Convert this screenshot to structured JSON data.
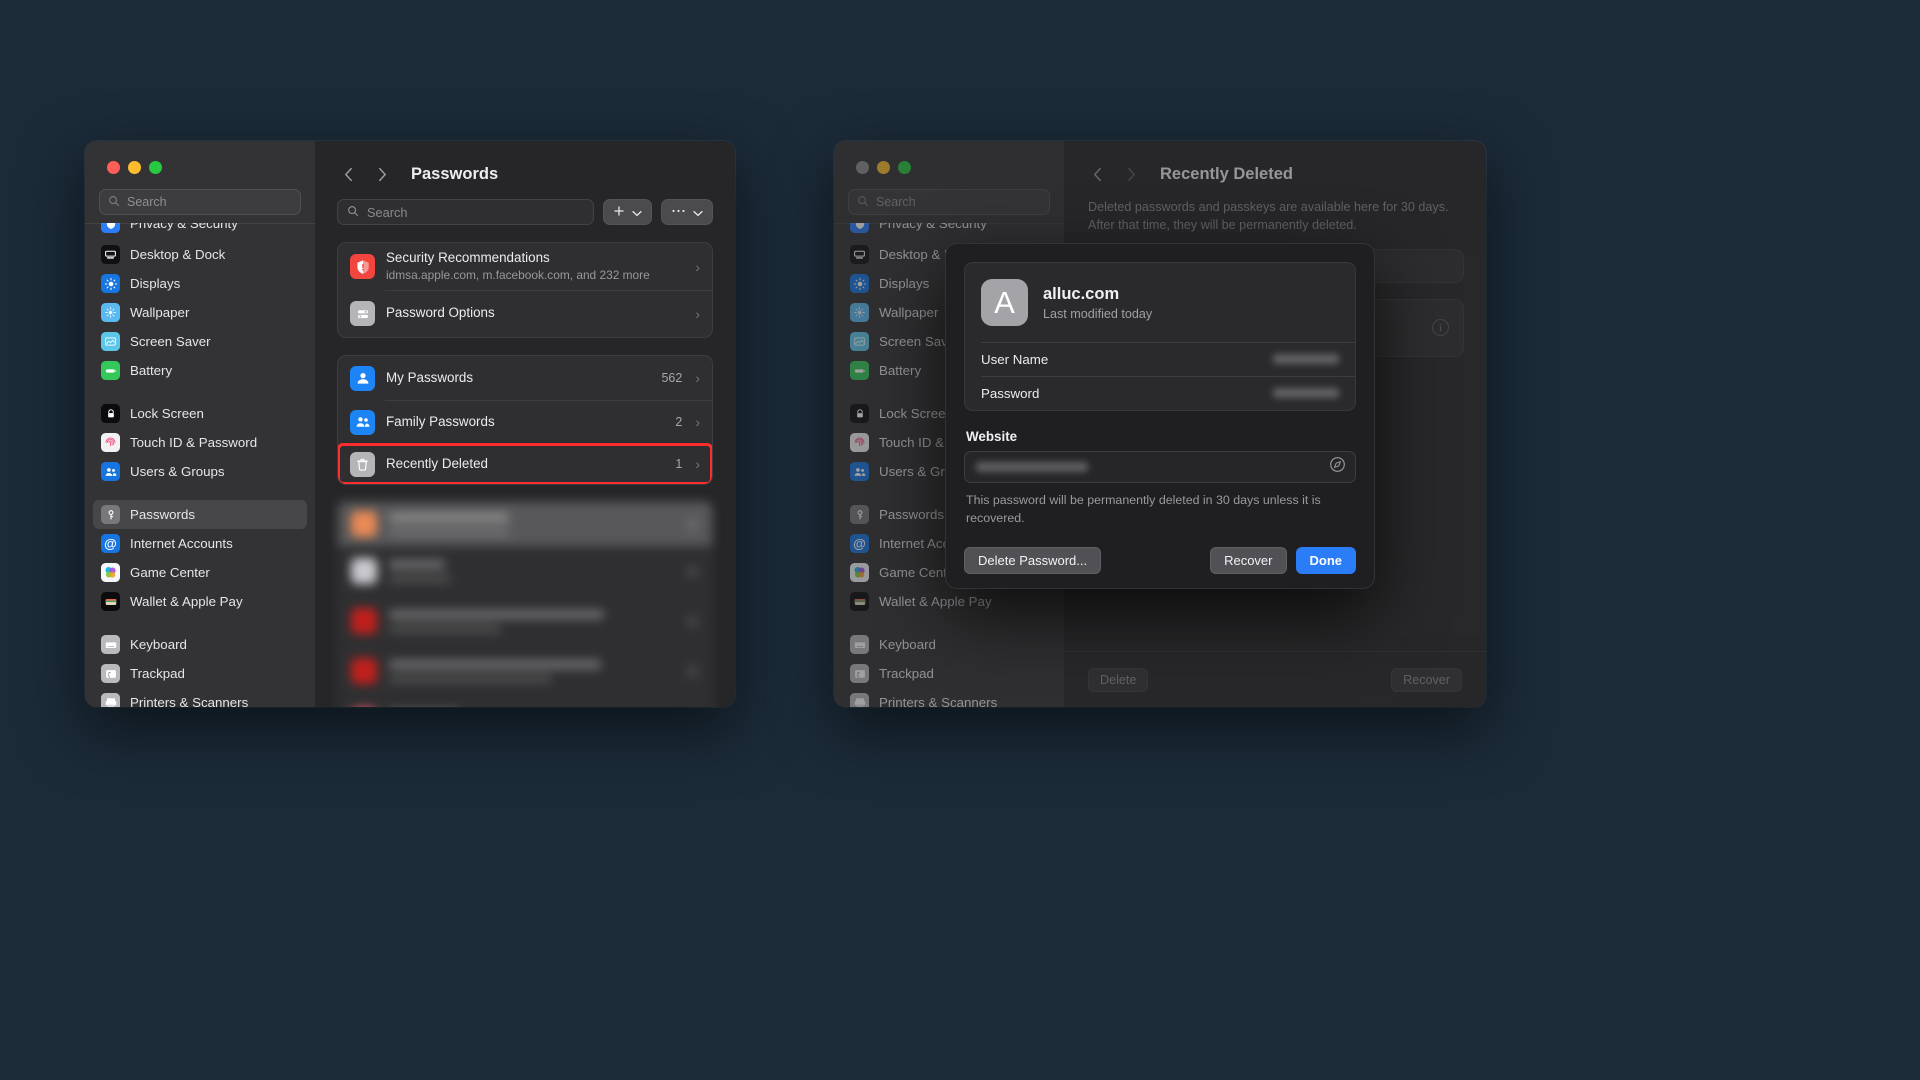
{
  "desktop": {
    "background_color": "#1b2b38"
  },
  "left_window": {
    "traffic_lights": {
      "close": "close",
      "minimize": "minimize",
      "zoom": "zoom"
    },
    "sidebar": {
      "search_placeholder": "Search",
      "clipped_item_label": "Privacy & Security",
      "items": [
        {
          "label": "Desktop & Dock",
          "icon": "desktop-dock-icon",
          "selected": false
        },
        {
          "label": "Displays",
          "icon": "displays-icon",
          "selected": false
        },
        {
          "label": "Wallpaper",
          "icon": "wallpaper-icon",
          "selected": false
        },
        {
          "label": "Screen Saver",
          "icon": "screen-saver-icon",
          "selected": false
        },
        {
          "label": "Battery",
          "icon": "battery-icon",
          "selected": false
        },
        {
          "label": "Lock Screen",
          "icon": "lock-screen-icon",
          "selected": false,
          "gap_before": true
        },
        {
          "label": "Touch ID & Password",
          "icon": "touch-id-icon",
          "selected": false
        },
        {
          "label": "Users & Groups",
          "icon": "users-groups-icon",
          "selected": false
        },
        {
          "label": "Passwords",
          "icon": "passwords-icon",
          "selected": true,
          "gap_before": true
        },
        {
          "label": "Internet Accounts",
          "icon": "internet-accounts-icon",
          "selected": false
        },
        {
          "label": "Game Center",
          "icon": "game-center-icon",
          "selected": false
        },
        {
          "label": "Wallet & Apple Pay",
          "icon": "wallet-apple-pay-icon",
          "selected": false
        },
        {
          "label": "Keyboard",
          "icon": "keyboard-icon",
          "selected": false,
          "gap_before": true
        },
        {
          "label": "Trackpad",
          "icon": "trackpad-icon",
          "selected": false
        },
        {
          "label": "Printers & Scanners",
          "icon": "printers-scanners-icon",
          "selected": false
        }
      ]
    },
    "toolbar": {
      "back_icon": "chevron-left-icon",
      "forward_icon": "chevron-right-icon",
      "title": "Passwords"
    },
    "search": {
      "placeholder": "Search",
      "value": ""
    },
    "add_button": {
      "label": "+",
      "icon": "plus-icon",
      "chevron": "chevron-down-icon"
    },
    "more_button": {
      "label": "···",
      "icon": "ellipsis-icon",
      "chevron": "chevron-down-icon"
    },
    "info_group": [
      {
        "title": "Security Recommendations",
        "subtitle": "idmsa.apple.com, m.facebook.com, and 232 more",
        "icon": "security-recommendations-icon",
        "chevron": "›"
      },
      {
        "title": "Password Options",
        "subtitle": "",
        "icon": "password-options-icon",
        "chevron": "›"
      }
    ],
    "collections": [
      {
        "title": "My Passwords",
        "count": "562",
        "icon": "person-icon",
        "chevron": "›",
        "highlighted": false
      },
      {
        "title": "Family Passwords",
        "count": "2",
        "icon": "people-icon",
        "chevron": "›",
        "highlighted": false
      },
      {
        "title": "Recently Deleted",
        "count": "1",
        "icon": "trash-icon",
        "chevron": "›",
        "highlighted": true
      }
    ],
    "highlight_color": "#ff2d2d",
    "redacted_list_note": "blurred password entries"
  },
  "right_window": {
    "traffic_lights": {
      "close": "close-inactive",
      "minimize": "minimize",
      "zoom": "zoom"
    },
    "sidebar": {
      "search_placeholder": "Search",
      "items": [
        {
          "label": "Desktop & Dock",
          "icon": "desktop-dock-icon"
        },
        {
          "label": "Displays",
          "icon": "displays-icon"
        },
        {
          "label": "Wallpaper",
          "icon": "wallpaper-icon"
        },
        {
          "label": "Screen Saver",
          "icon": "screen-saver-icon"
        },
        {
          "label": "Battery",
          "icon": "battery-icon"
        },
        {
          "label": "Lock Screen",
          "icon": "lock-screen-icon",
          "gap_before": true
        },
        {
          "label": "Touch ID & Password",
          "icon": "touch-id-icon"
        },
        {
          "label": "Users & Groups",
          "icon": "users-groups-icon"
        },
        {
          "label": "Passwords",
          "icon": "passwords-icon",
          "gap_before": true
        },
        {
          "label": "Internet Accounts",
          "icon": "internet-accounts-icon"
        },
        {
          "label": "Game Center",
          "icon": "game-center-icon"
        },
        {
          "label": "Wallet & Apple Pay",
          "icon": "wallet-apple-pay-icon"
        },
        {
          "label": "Keyboard",
          "icon": "keyboard-icon",
          "gap_before": true
        },
        {
          "label": "Trackpad",
          "icon": "trackpad-icon"
        },
        {
          "label": "Printers & Scanners",
          "icon": "printers-scanners-icon"
        }
      ]
    },
    "toolbar": {
      "back_icon": "chevron-left-icon",
      "forward_icon": "chevron-right-icon",
      "title": "Recently Deleted"
    },
    "description": "Deleted passwords and passkeys are available here for 30 days. After that time, they will be permanently deleted.",
    "info_icon": "info-circle-icon",
    "footer": {
      "delete_label": "Delete",
      "recover_label": "Recover"
    }
  },
  "sheet": {
    "avatar_letter": "A",
    "site_name": "alluc.com",
    "last_modified": "Last modified today",
    "fields": [
      {
        "label": "User Name",
        "value_redacted": true
      },
      {
        "label": "Password",
        "value_redacted": true
      }
    ],
    "website_section_label": "Website",
    "website_value_redacted": true,
    "website_open_icon": "safari-compass-icon",
    "note": "This password will be permanently deleted in 30 days unless it is recovered.",
    "buttons": {
      "delete": "Delete Password...",
      "recover": "Recover",
      "done": "Done"
    },
    "accent_color": "#2b7cf7"
  }
}
